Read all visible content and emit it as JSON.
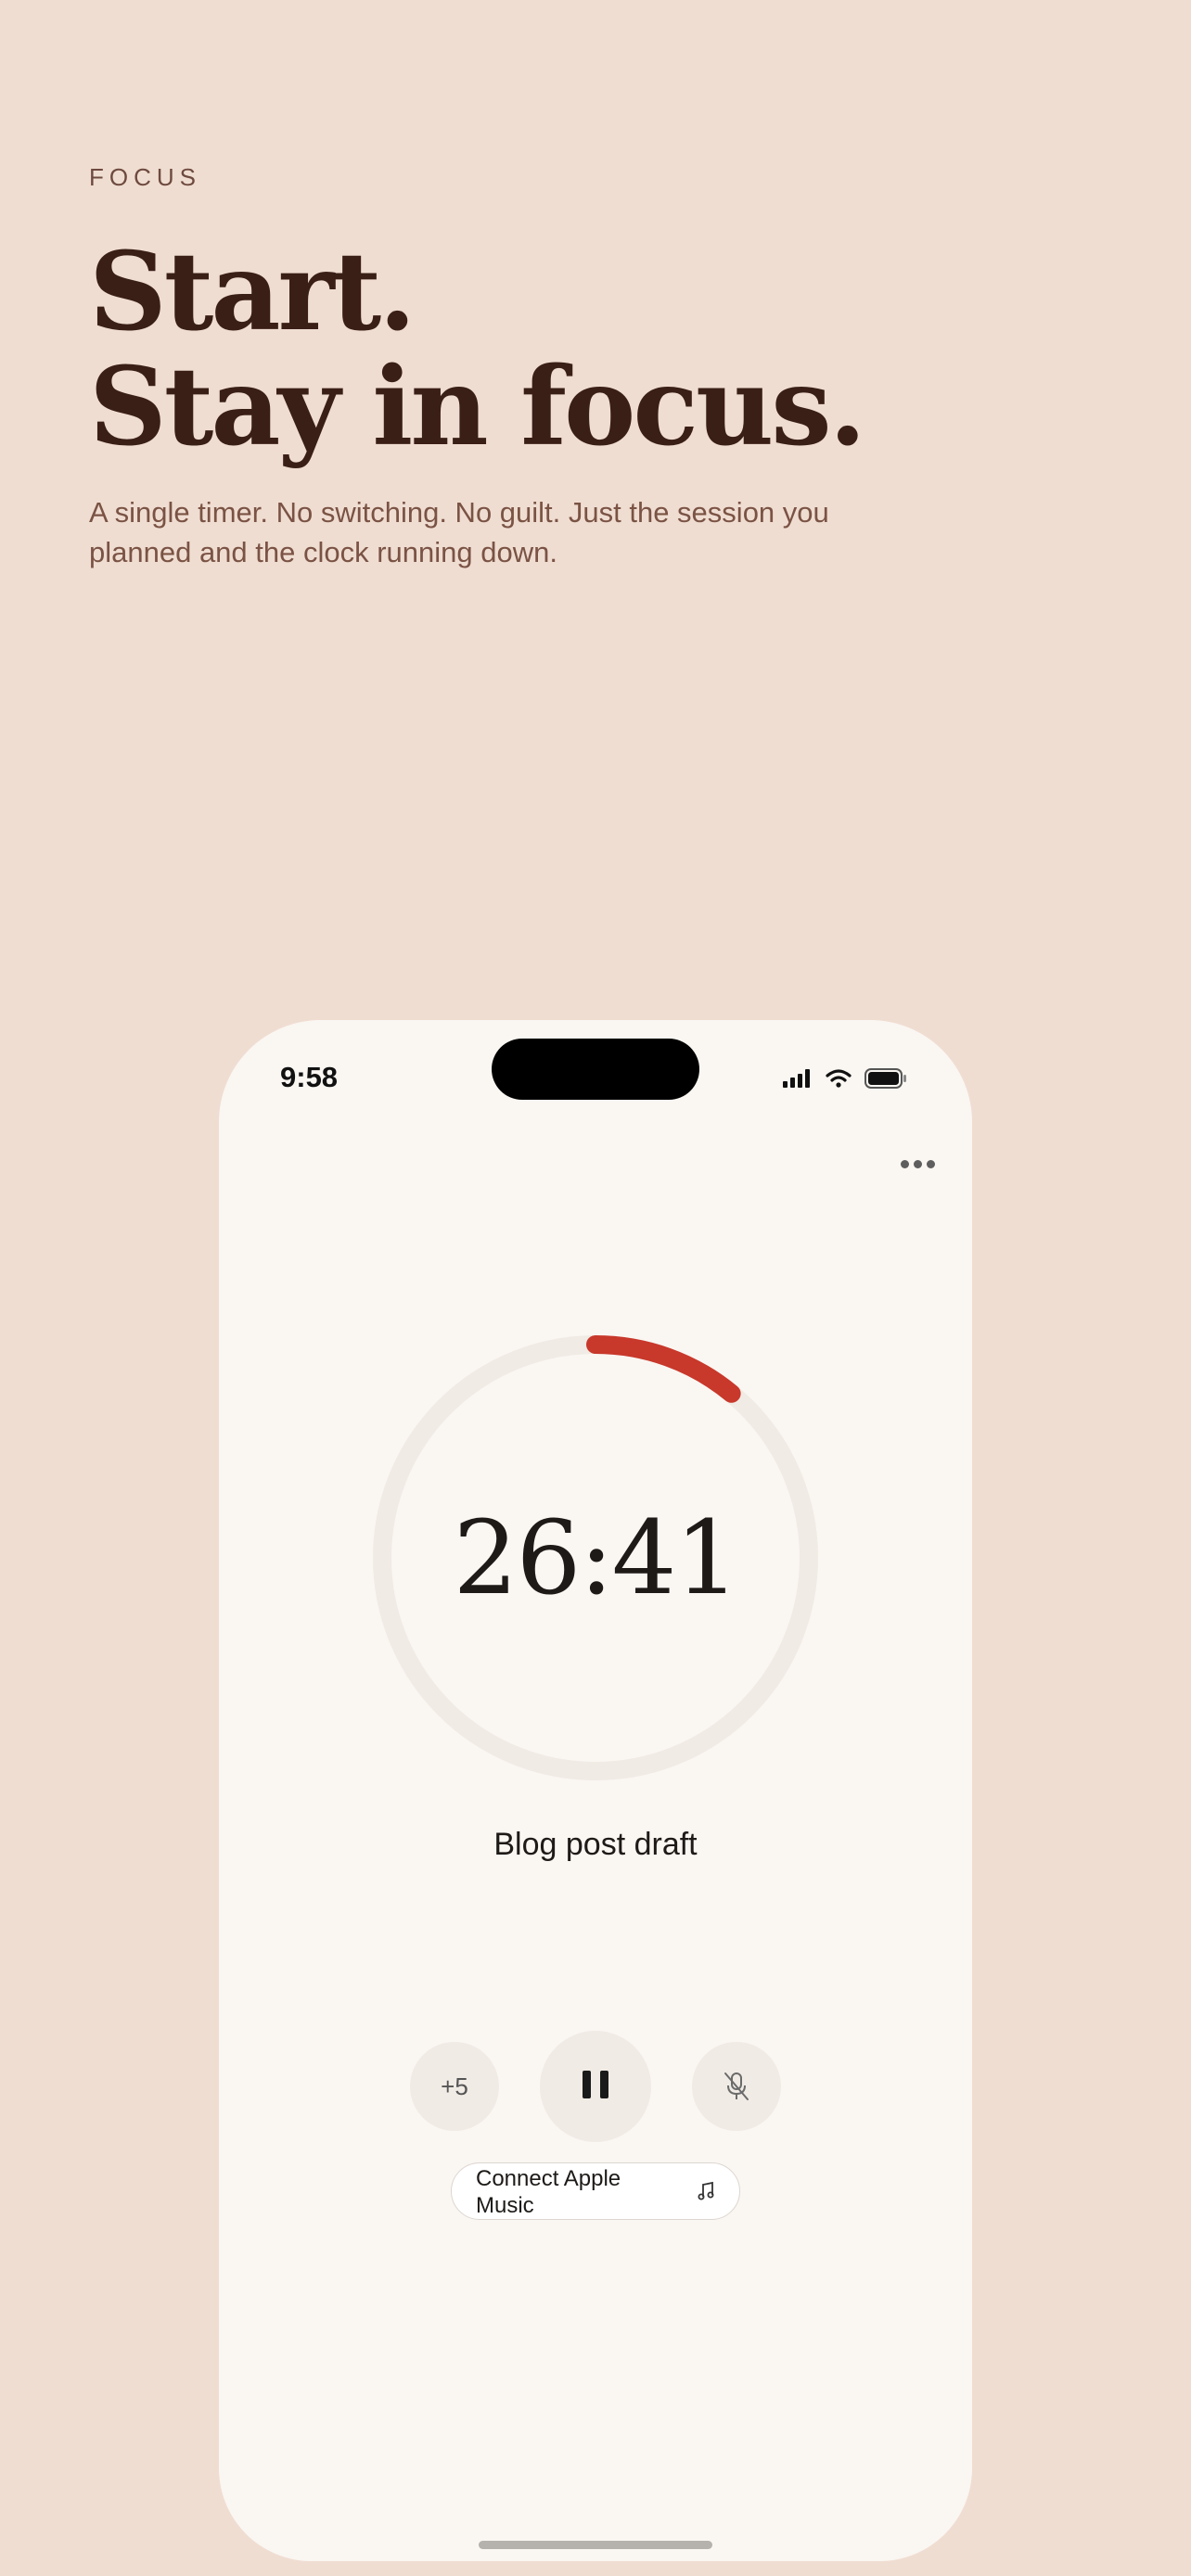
{
  "hero": {
    "eyebrow": "FOCUS",
    "headline_line1": "Start.",
    "headline_line2": "Stay in focus.",
    "subcopy": "A single timer. No switching. No guilt. Just the session you planned and the clock running down."
  },
  "status_bar": {
    "time": "9:58",
    "icons": [
      "cellular-signal-icon",
      "wifi-icon",
      "battery-icon"
    ]
  },
  "menu": {
    "icon": "more-horizontal-icon"
  },
  "timer": {
    "display": "26:41",
    "progress": 0.11,
    "progress_color": "#c8382b",
    "track_color": "#f1ebe5",
    "task": "Blog post draft"
  },
  "controls": {
    "add_label": "+5",
    "pause_icon": "pause-icon",
    "mute_icon": "microphone-off-icon"
  },
  "music": {
    "label": "Connect Apple Music",
    "icon": "music-note-icon"
  }
}
